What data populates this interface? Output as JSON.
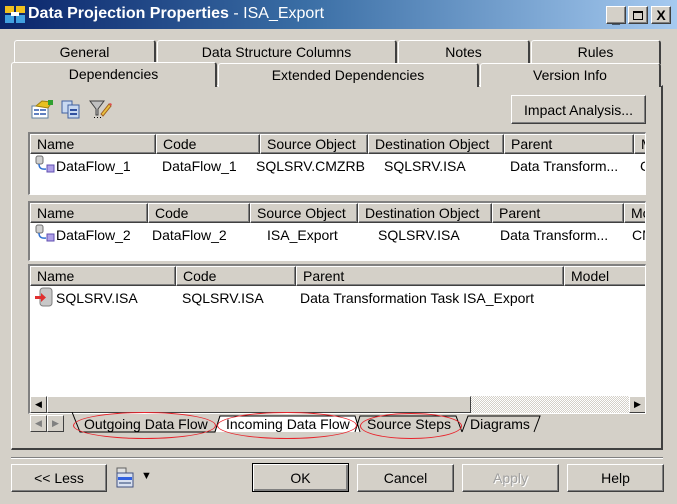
{
  "window": {
    "title_bold": "Data Projection Properties",
    "title_sub": " - ISA_Export",
    "icon": "properties-icon",
    "controls": {
      "minimize": "_",
      "maximize": "□",
      "close": "X"
    }
  },
  "tabs": {
    "row_back": [
      {
        "label": "General"
      },
      {
        "label": "Data Structure Columns"
      },
      {
        "label": "Notes"
      },
      {
        "label": "Rules"
      }
    ],
    "row_front": [
      {
        "label": "Dependencies",
        "active": true
      },
      {
        "label": "Extended Dependencies"
      },
      {
        "label": "Version Info"
      }
    ]
  },
  "toolbar": {
    "icons": [
      "properties-icon",
      "copy-icon",
      "filter-icon"
    ],
    "impact_analysis_label": "Impact Analysis..."
  },
  "outgoing_list": {
    "columns": [
      "Name",
      "Code",
      "Source Object",
      "Destination Object",
      "Parent",
      "M"
    ],
    "rows": [
      {
        "icon": "dataflow-icon",
        "name": "DataFlow_1",
        "code": "DataFlow_1",
        "source": "SQLSRV.CMZRB",
        "destination": "SQLSRV.ISA",
        "parent": "Data Transform...",
        "model": "C"
      }
    ]
  },
  "incoming_list": {
    "columns": [
      "Name",
      "Code",
      "Source Object",
      "Destination Object",
      "Parent",
      "Mo"
    ],
    "rows": [
      {
        "icon": "dataflow-icon",
        "name": "DataFlow_2",
        "code": "DataFlow_2",
        "source": "ISA_Export",
        "destination": "SQLSRV.ISA",
        "parent": "Data Transform...",
        "model": "CM"
      }
    ]
  },
  "source_steps_list": {
    "columns": [
      "Name",
      "Code",
      "Parent",
      "Model"
    ],
    "rows": [
      {
        "icon": "source-step-icon",
        "name": "SQLSRV.ISA",
        "code": "SQLSRV.ISA",
        "parent": "Data Transformation Task ISA_Export",
        "model": ""
      }
    ]
  },
  "bottom_tabs": [
    {
      "label": "Outgoing Data Flow",
      "highlighted": true
    },
    {
      "label": "Incoming Data Flow",
      "highlighted": true,
      "active": true
    },
    {
      "label": "Source Steps",
      "highlighted": true
    },
    {
      "label": "Diagrams",
      "highlighted": false
    }
  ],
  "footer": {
    "less_label": "<< Less",
    "ok_label": "OK",
    "cancel_label": "Cancel",
    "apply_label": "Apply",
    "help_label": "Help"
  },
  "colors": {
    "highlight_ellipse": "#e8242c",
    "titlebar_start": "#0a246a",
    "titlebar_end": "#a6caf0"
  }
}
